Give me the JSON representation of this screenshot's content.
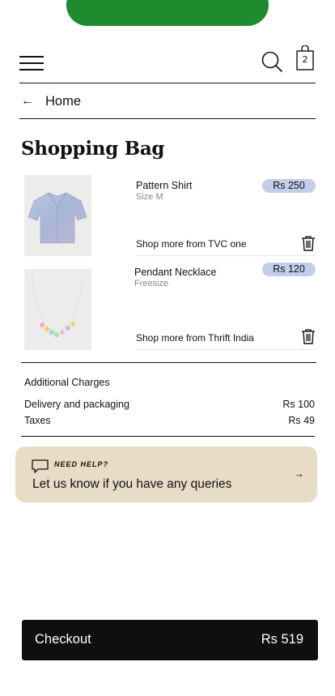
{
  "colors": {
    "brand_green": "#1e8c2e",
    "price_pill_bg": "#c3cfe9",
    "help_card_bg": "#e8dcc6",
    "checkout_bg": "#0f0f0f"
  },
  "header": {
    "menu_icon": "hamburger-icon",
    "search_icon": "search-icon",
    "bag_icon": "shopping-bag-icon",
    "bag_count": "2"
  },
  "breadcrumb": {
    "back_icon": "arrow-left-icon",
    "label": "Home"
  },
  "page_title": "Shopping Bag",
  "items": [
    {
      "name": "Pattern Shirt",
      "variant": "Size M",
      "price": "Rs 250",
      "shop_more": "Shop more from TVC one",
      "image": "shirt-image"
    },
    {
      "name": "Pendant Necklace",
      "variant": "Freesize",
      "price": "Rs 120",
      "shop_more": "Shop more from Thrift India",
      "image": "necklace-image"
    }
  ],
  "charges": {
    "title": "Additional Charges",
    "rows": [
      {
        "label": "Delivery and packaging",
        "value": "Rs 100"
      },
      {
        "label": "Taxes",
        "value": "Rs 49"
      }
    ]
  },
  "help": {
    "kicker": "NEED HELP?",
    "text": "Let us know if you have any queries",
    "icon": "chat-bubble-icon"
  },
  "checkout": {
    "label": "Checkout",
    "total": "Rs 519"
  }
}
